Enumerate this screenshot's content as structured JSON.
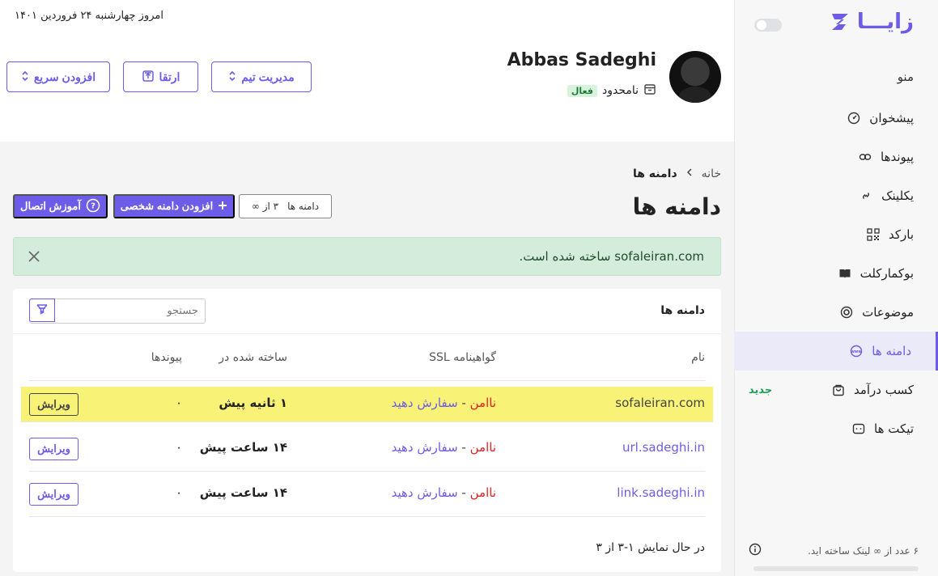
{
  "header": {
    "date_text": "امروز چهارشنبه ۲۴ فروردین ۱۴۰۱",
    "user_name": "Abbas Sadeghi",
    "plan_label": "نامحدود",
    "plan_status": "فعال",
    "buttons": {
      "team": "مدیریت تیم",
      "upgrade": "ارتقا",
      "quick_add": "افزودن سریع"
    }
  },
  "sidebar": {
    "logo_text": "زایـــا",
    "menu_title": "منو",
    "items": [
      {
        "label": "پیشخوان",
        "icon": "gauge-icon",
        "active": false
      },
      {
        "label": "پیوندها",
        "icon": "link-icon",
        "active": false
      },
      {
        "label": "یکلینک",
        "icon": "chain-icon",
        "active": false
      },
      {
        "label": "بارکد",
        "icon": "qrcode-icon",
        "active": false
      },
      {
        "label": "بوکمارکلت",
        "icon": "book-icon",
        "active": false
      },
      {
        "label": "موضوعات",
        "icon": "target-icon",
        "active": false
      },
      {
        "label": "دامنه ها",
        "icon": "www-icon",
        "active": true
      },
      {
        "label": "کسب درآمد",
        "icon": "bag-icon",
        "active": false,
        "badge": "جدید"
      },
      {
        "label": "تیکت ها",
        "icon": "ticket-icon",
        "active": false
      }
    ],
    "footer_text": "۶ عدد از ∞ لینک ساخته اید.",
    "usage_fraction": 0
  },
  "breadcrumb": {
    "home": "خانه",
    "current": "دامنه ها"
  },
  "page": {
    "title": "دامنه ها",
    "count_label": "دامنه ها",
    "count_value": "۳ از ∞",
    "add_domain_btn": "افزودن دامنه شخصی",
    "tutorial_btn": "آموزش اتصال"
  },
  "alert": {
    "domain": "sofaleiran.com",
    "message": "ساخته شده است."
  },
  "table": {
    "title": "دامنه ها",
    "search_placeholder": "جستجو",
    "columns": {
      "name": "نام",
      "ssl": "گواهینامه SSL",
      "created": "ساخته شده در",
      "links": "پیوندها"
    },
    "rows": [
      {
        "domain": "sofaleiran.com",
        "ssl_status": "ناامن",
        "ssl_action": "سفارش دهید",
        "created": "۱ ثانیه پیش",
        "links": "۰",
        "edit": "ویرایش",
        "highlight": true
      },
      {
        "domain": "url.sadeghi.in",
        "ssl_status": "ناامن",
        "ssl_action": "سفارش دهید",
        "created": "۱۴ ساعت پیش",
        "links": "۰",
        "edit": "ویرایش",
        "highlight": false
      },
      {
        "domain": "link.sadeghi.in",
        "ssl_status": "ناامن",
        "ssl_action": "سفارش دهید",
        "created": "۱۴ ساعت پیش",
        "links": "۰",
        "edit": "ویرایش",
        "highlight": false
      }
    ],
    "pager_text": "در حال نمایش ۱-۳ از ۳"
  },
  "colors": {
    "accent": "#6c5ce7",
    "success": "#1f9d55",
    "danger": "#e02424",
    "highlight": "#f8f277"
  }
}
